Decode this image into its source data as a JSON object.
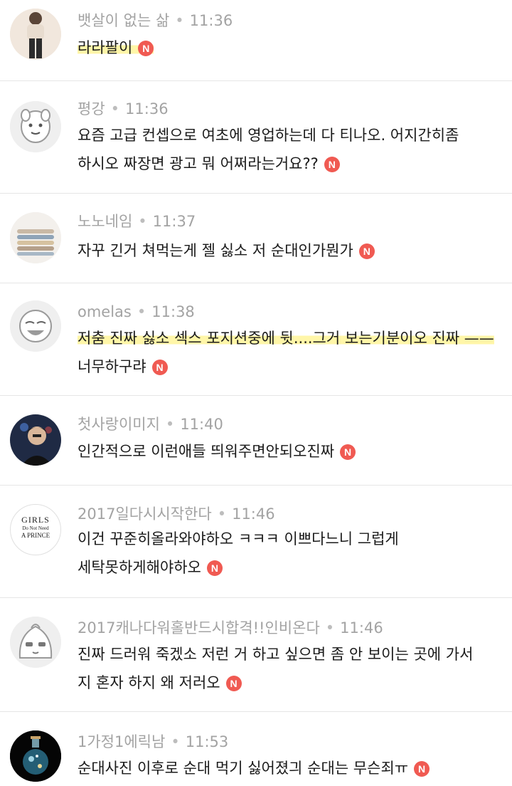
{
  "comments": [
    {
      "author": "뱃살이 없는 삶",
      "time": "11:36",
      "avatar_icon": "person-photo-icon",
      "lines": [
        "라라팔이"
      ],
      "badge": "N"
    },
    {
      "author": "평강",
      "time": "11:36",
      "avatar_icon": "cartoon-character-icon",
      "lines": [
        "요즘 고급 컨셉으로 여초에 영업하는데 다 티나오. 어지간히좀",
        "하시오 짜장면 광고 뭐 어쩌라는거요??"
      ],
      "badge": "N"
    },
    {
      "author": "노노네임",
      "time": "11:37",
      "avatar_icon": "stacked-bracelets-icon",
      "lines": [
        "자꾸 긴거 쳐먹는게 젤 싫소 저 순대인가뭔가"
      ],
      "badge": "N"
    },
    {
      "author": "omelas",
      "time": "11:38",
      "avatar_icon": "cartoon-face-icon",
      "lines": [
        "저춤 진짜 싫소 섹스 포지션중에 뒷....그거 보는기분이오 진짜 ——",
        "너무하구랴"
      ],
      "badge": "N"
    },
    {
      "author": "첫사랑이미지",
      "time": "11:40",
      "avatar_icon": "person-photo-icon",
      "lines": [
        "인간적으로 이런애들 띄워주면안되오진짜"
      ],
      "badge": "N"
    },
    {
      "author": "2017일다시시작한다",
      "time": "11:46",
      "avatar_icon": "text-logo-icon",
      "avatar_text": [
        "GIRLS",
        "Do Not Need",
        "A PRINCE"
      ],
      "lines": [
        "이건 꾸준히올라와야하오 ㅋㅋㅋ 이쁘다느니 그럽게",
        "세탁못하게해야하오"
      ],
      "badge": "N"
    },
    {
      "author": "2017캐나다워홀반드시합격!!인비온다",
      "time": "11:46",
      "avatar_icon": "cartoon-character-icon",
      "lines": [
        "진짜 드러워 죽겠소 저런 거 하고 싶으면 좀 안 보이는 곳에 가서",
        "지 혼자 하지 왜 저러오"
      ],
      "badge": "N"
    },
    {
      "author": "1가정1에릭남",
      "time": "11:53",
      "avatar_icon": "potion-bottle-icon",
      "lines": [
        "순대사진 이후로 순대 먹기 싫어졌긔 순대는 무슨죄ㅠ"
      ],
      "badge": "N"
    }
  ],
  "colors": {
    "meta": "#a3a3a3",
    "text": "#1a1a1a",
    "highlight": "#fff6a8",
    "badge": "#f05a52",
    "divider": "#e6e6e6"
  }
}
